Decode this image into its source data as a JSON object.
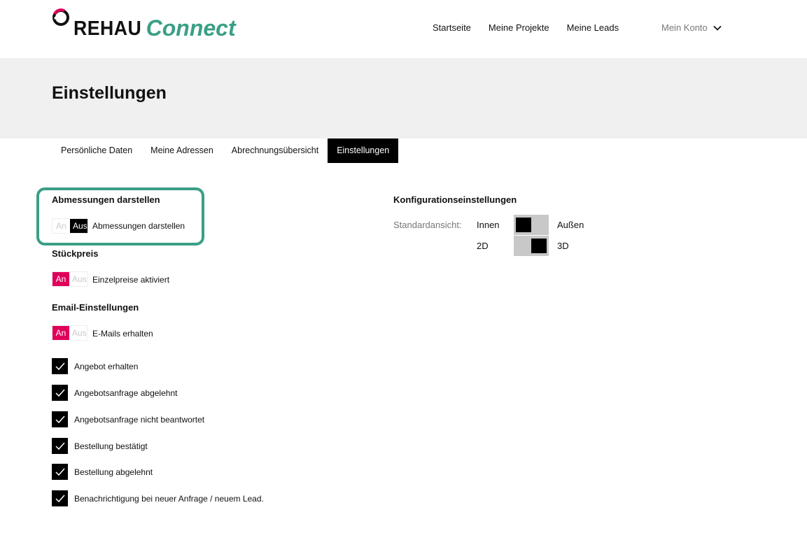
{
  "brand": {
    "name": "REHAU",
    "product": "Connect",
    "accent": "#3a9f86",
    "pink": "#e0005a"
  },
  "nav": {
    "items": [
      "Startseite",
      "Meine Projekte",
      "Meine Leads"
    ],
    "account": "Mein Konto"
  },
  "page": {
    "title": "Einstellungen"
  },
  "tabs": [
    {
      "label": "Persönliche Daten",
      "active": false
    },
    {
      "label": "Meine Adressen",
      "active": false
    },
    {
      "label": "Abrechnungsübersicht",
      "active": false
    },
    {
      "label": "Einstellungen",
      "active": true
    }
  ],
  "dimensions": {
    "title": "Abmessungen darstellen",
    "on": "An",
    "off": "Aus",
    "state": "Aus",
    "label": "Abmessungen darstellen"
  },
  "price": {
    "title": "Stückpreis",
    "on": "An",
    "off": "Aus",
    "state": "An",
    "label": "Einzelpreise aktiviert"
  },
  "email": {
    "title": "Email-Einstellungen",
    "on": "An",
    "off": "Aus",
    "state": "An",
    "label": "E-Mails erhalten",
    "checkboxes": [
      {
        "label": "Angebot erhalten",
        "checked": true
      },
      {
        "label": "Angebotsanfrage abgelehnt",
        "checked": true
      },
      {
        "label": "Angebotsanfrage nicht beantwortet",
        "checked": true
      },
      {
        "label": "Bestellung bestätigt",
        "checked": true
      },
      {
        "label": "Bestellung abgelehnt",
        "checked": true
      },
      {
        "label": "Benachrichtigung bei neuer Anfrage / neuem Lead.",
        "checked": true
      }
    ]
  },
  "config": {
    "title": "Konfigurationseinstellungen",
    "default_view_label": "Standardansicht:",
    "view_left": "Innen",
    "view_right": "Außen",
    "view_selected": "Innen",
    "dim_left": "2D",
    "dim_right": "3D",
    "dim_selected": "3D"
  }
}
